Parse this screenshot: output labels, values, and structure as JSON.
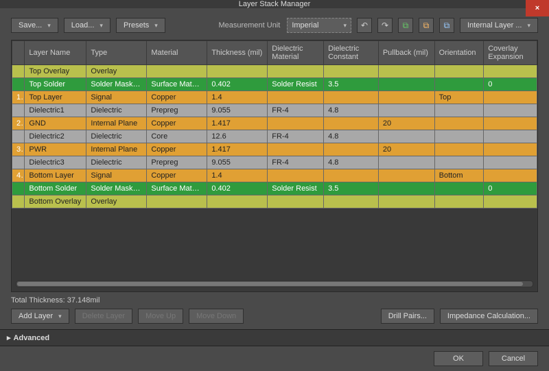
{
  "window": {
    "title": "Layer Stack Manager",
    "close_label": "×"
  },
  "toolbar": {
    "save": "Save...",
    "load": "Load...",
    "presets": "Presets",
    "measurement_label": "Measurement Unit",
    "measurement_value": "Imperial",
    "layer_type_dropdown": "Internal Layer ..."
  },
  "columns": [
    "Layer Name",
    "Type",
    "Material",
    "Thickness (mil)",
    "Dielectric Material",
    "Dielectric Constant",
    "Pullback (mil)",
    "Orientation",
    "Coverlay Expansion"
  ],
  "rows": [
    {
      "style": "olive",
      "num": "",
      "name": "Top Overlay",
      "type": "Overlay",
      "material": "",
      "thickness": "",
      "dmat": "",
      "dconst": "",
      "pull": "",
      "orient": "",
      "cov": ""
    },
    {
      "style": "green",
      "num": "",
      "name": "Top Solder",
      "type": "Solder Mask/Co...",
      "material": "Surface Material",
      "thickness": "0.402",
      "dmat": "Solder Resist",
      "dconst": "3.5",
      "pull": "",
      "orient": "",
      "cov": "0"
    },
    {
      "style": "orange",
      "num": "1",
      "name": "Top Layer",
      "type": "Signal",
      "material": "Copper",
      "thickness": "1.4",
      "dmat": "",
      "dconst": "",
      "pull": "",
      "orient": "Top",
      "cov": ""
    },
    {
      "style": "gray",
      "num": "",
      "name": "Dielectric1",
      "type": "Dielectric",
      "material": "Prepreg",
      "thickness": "9.055",
      "dmat": "FR-4",
      "dconst": "4.8",
      "pull": "",
      "orient": "",
      "cov": ""
    },
    {
      "style": "orange",
      "num": "2",
      "name": "GND",
      "type": "Internal Plane",
      "material": "Copper",
      "thickness": "1.417",
      "dmat": "",
      "dconst": "",
      "pull": "20",
      "orient": "",
      "cov": ""
    },
    {
      "style": "gray",
      "num": "",
      "name": "Dielectric2",
      "type": "Dielectric",
      "material": "Core",
      "thickness": "12.6",
      "dmat": "FR-4",
      "dconst": "4.8",
      "pull": "",
      "orient": "",
      "cov": ""
    },
    {
      "style": "orange",
      "num": "3",
      "name": "PWR",
      "type": "Internal Plane",
      "material": "Copper",
      "thickness": "1.417",
      "dmat": "",
      "dconst": "",
      "pull": "20",
      "orient": "",
      "cov": ""
    },
    {
      "style": "gray",
      "num": "",
      "name": "Dielectric3",
      "type": "Dielectric",
      "material": "Prepreg",
      "thickness": "9.055",
      "dmat": "FR-4",
      "dconst": "4.8",
      "pull": "",
      "orient": "",
      "cov": ""
    },
    {
      "style": "orange",
      "num": "4",
      "name": "Bottom Layer",
      "type": "Signal",
      "material": "Copper",
      "thickness": "1.4",
      "dmat": "",
      "dconst": "",
      "pull": "",
      "orient": "Bottom",
      "cov": ""
    },
    {
      "style": "green",
      "num": "",
      "name": "Bottom Solder",
      "type": "Solder Mask/Co...",
      "material": "Surface Material",
      "thickness": "0.402",
      "dmat": "Solder Resist",
      "dconst": "3.5",
      "pull": "",
      "orient": "",
      "cov": "0"
    },
    {
      "style": "olive",
      "num": "",
      "name": "Bottom Overlay",
      "type": "Overlay",
      "material": "",
      "thickness": "",
      "dmat": "",
      "dconst": "",
      "pull": "",
      "orient": "",
      "cov": ""
    }
  ],
  "status": {
    "total_thickness": "Total Thickness: 37.148mil"
  },
  "buttons": {
    "add_layer": "Add Layer",
    "delete_layer": "Delete Layer",
    "move_up": "Move Up",
    "move_down": "Move Down",
    "drill_pairs": "Drill Pairs...",
    "impedance": "Impedance Calculation...",
    "advanced": "Advanced",
    "ok": "OK",
    "cancel": "Cancel"
  }
}
